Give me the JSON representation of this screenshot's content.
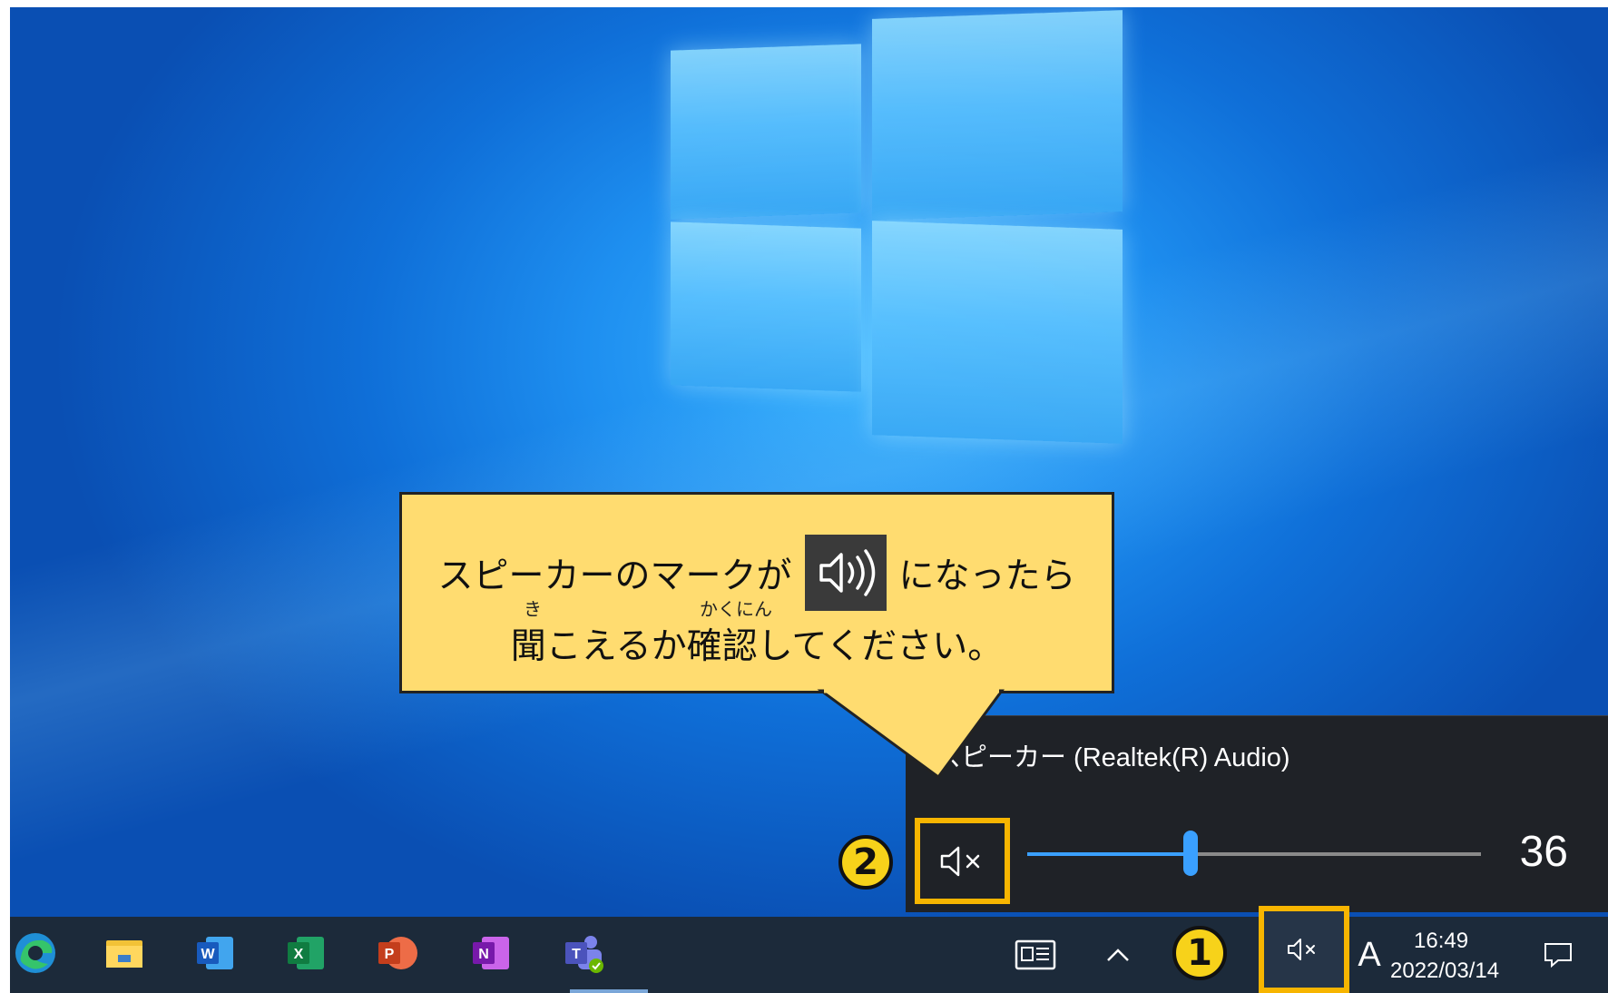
{
  "callout": {
    "line1_before": "スピーカーのマークが",
    "line1_after": "になったら",
    "line2": "聞こえるか確認してください。",
    "ruby_ki": "き",
    "ruby_kakunin": "かくにん",
    "icon": "speaker-on-icon"
  },
  "flyout": {
    "device_name": "スピーカー (Realtek(R) Audio)",
    "volume": 36,
    "volume_label": "36",
    "muted": true,
    "mute_icon": "speaker-muted-icon"
  },
  "badges": {
    "step1": "1",
    "step2": "2"
  },
  "taskbar": {
    "apps": [
      {
        "name": "Edge",
        "icon": "edge-icon"
      },
      {
        "name": "File Explorer",
        "icon": "file-explorer-icon"
      },
      {
        "name": "Word",
        "icon": "word-icon",
        "letter": "W"
      },
      {
        "name": "Excel",
        "icon": "excel-icon",
        "letter": "X"
      },
      {
        "name": "PowerPoint",
        "icon": "powerpoint-icon",
        "letter": "P"
      },
      {
        "name": "OneNote",
        "icon": "onenote-icon",
        "letter": "N"
      },
      {
        "name": "Teams",
        "icon": "teams-icon",
        "letter": "T"
      }
    ],
    "ime_label": "A",
    "time": "16:49",
    "date": "2022/03/14"
  },
  "colors": {
    "highlight": "#f7b500",
    "callout_bg": "#ffdc70",
    "accent": "#3aa0ff",
    "taskbar": "#1c2a3a"
  }
}
